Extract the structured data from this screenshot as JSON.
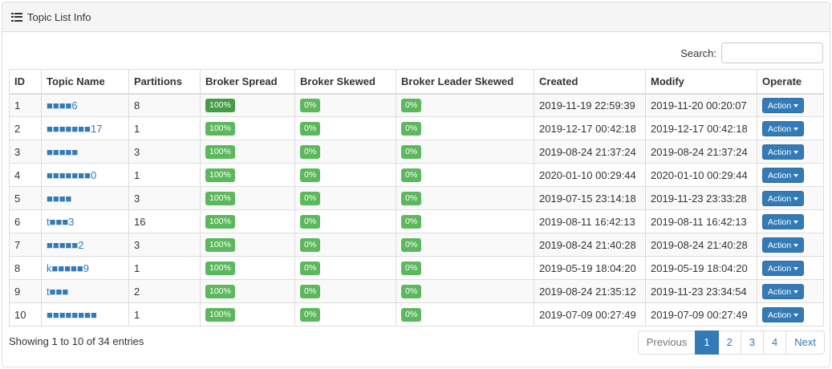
{
  "panel": {
    "title": "Topic List Info",
    "icon": "list-icon"
  },
  "search": {
    "label": "Search:",
    "value": "",
    "placeholder": ""
  },
  "table": {
    "columns": [
      "ID",
      "Topic Name",
      "Partitions",
      "Broker Spread",
      "Broker Skewed",
      "Broker Leader Skewed",
      "Created",
      "Modify",
      "Operate"
    ],
    "rows": [
      {
        "id": "1",
        "topic": "■■■■6",
        "partitions": "8",
        "spread": "100%",
        "skewed": "0%",
        "leader_skewed": "0%",
        "created": "2019-11-19 22:59:39",
        "modify": "2019-11-20 00:20:07",
        "action": "Action"
      },
      {
        "id": "2",
        "topic": "■■■■■■■17",
        "partitions": "1",
        "spread": "100%",
        "skewed": "0%",
        "leader_skewed": "0%",
        "created": "2019-12-17 00:42:18",
        "modify": "2019-12-17 00:42:18",
        "action": "Action"
      },
      {
        "id": "3",
        "topic": "■■■■■",
        "partitions": "3",
        "spread": "100%",
        "skewed": "0%",
        "leader_skewed": "0%",
        "created": "2019-08-24 21:37:24",
        "modify": "2019-08-24 21:37:24",
        "action": "Action"
      },
      {
        "id": "4",
        "topic": "■■■■■■■0",
        "partitions": "1",
        "spread": "100%",
        "skewed": "0%",
        "leader_skewed": "0%",
        "created": "2020-01-10 00:29:44",
        "modify": "2020-01-10 00:29:44",
        "action": "Action"
      },
      {
        "id": "5",
        "topic": "■■■■",
        "partitions": "3",
        "spread": "100%",
        "skewed": "0%",
        "leader_skewed": "0%",
        "created": "2019-07-15 23:14:18",
        "modify": "2019-11-23 23:33:28",
        "action": "Action"
      },
      {
        "id": "6",
        "topic": "t■■■3",
        "partitions": "16",
        "spread": "100%",
        "skewed": "0%",
        "leader_skewed": "0%",
        "created": "2019-08-11 16:42:13",
        "modify": "2019-08-11 16:42:13",
        "action": "Action"
      },
      {
        "id": "7",
        "topic": "■■■■■2",
        "partitions": "3",
        "spread": "100%",
        "skewed": "0%",
        "leader_skewed": "0%",
        "created": "2019-08-24 21:40:28",
        "modify": "2019-08-24 21:40:28",
        "action": "Action"
      },
      {
        "id": "8",
        "topic": "k■■■■■9",
        "partitions": "1",
        "spread": "100%",
        "skewed": "0%",
        "leader_skewed": "0%",
        "created": "2019-05-19 18:04:20",
        "modify": "2019-05-19 18:04:20",
        "action": "Action"
      },
      {
        "id": "9",
        "topic": "t■■■",
        "partitions": "2",
        "spread": "100%",
        "skewed": "0%",
        "leader_skewed": "0%",
        "created": "2019-08-24 21:35:12",
        "modify": "2019-11-23 23:34:54",
        "action": "Action"
      },
      {
        "id": "10",
        "topic": "■■■■■■■■",
        "partitions": "1",
        "spread": "100%",
        "skewed": "0%",
        "leader_skewed": "0%",
        "created": "2019-07-09 00:27:49",
        "modify": "2019-07-09 00:27:49",
        "action": "Action"
      }
    ]
  },
  "footer": {
    "info": "Showing 1 to 10 of 34 entries",
    "pagination": {
      "previous": "Previous",
      "pages": [
        "1",
        "2",
        "3",
        "4"
      ],
      "active_page": "1",
      "next": "Next"
    }
  },
  "colors": {
    "primary": "#337ab7",
    "success": "#5cb85c",
    "success_dark": "#449d44"
  }
}
